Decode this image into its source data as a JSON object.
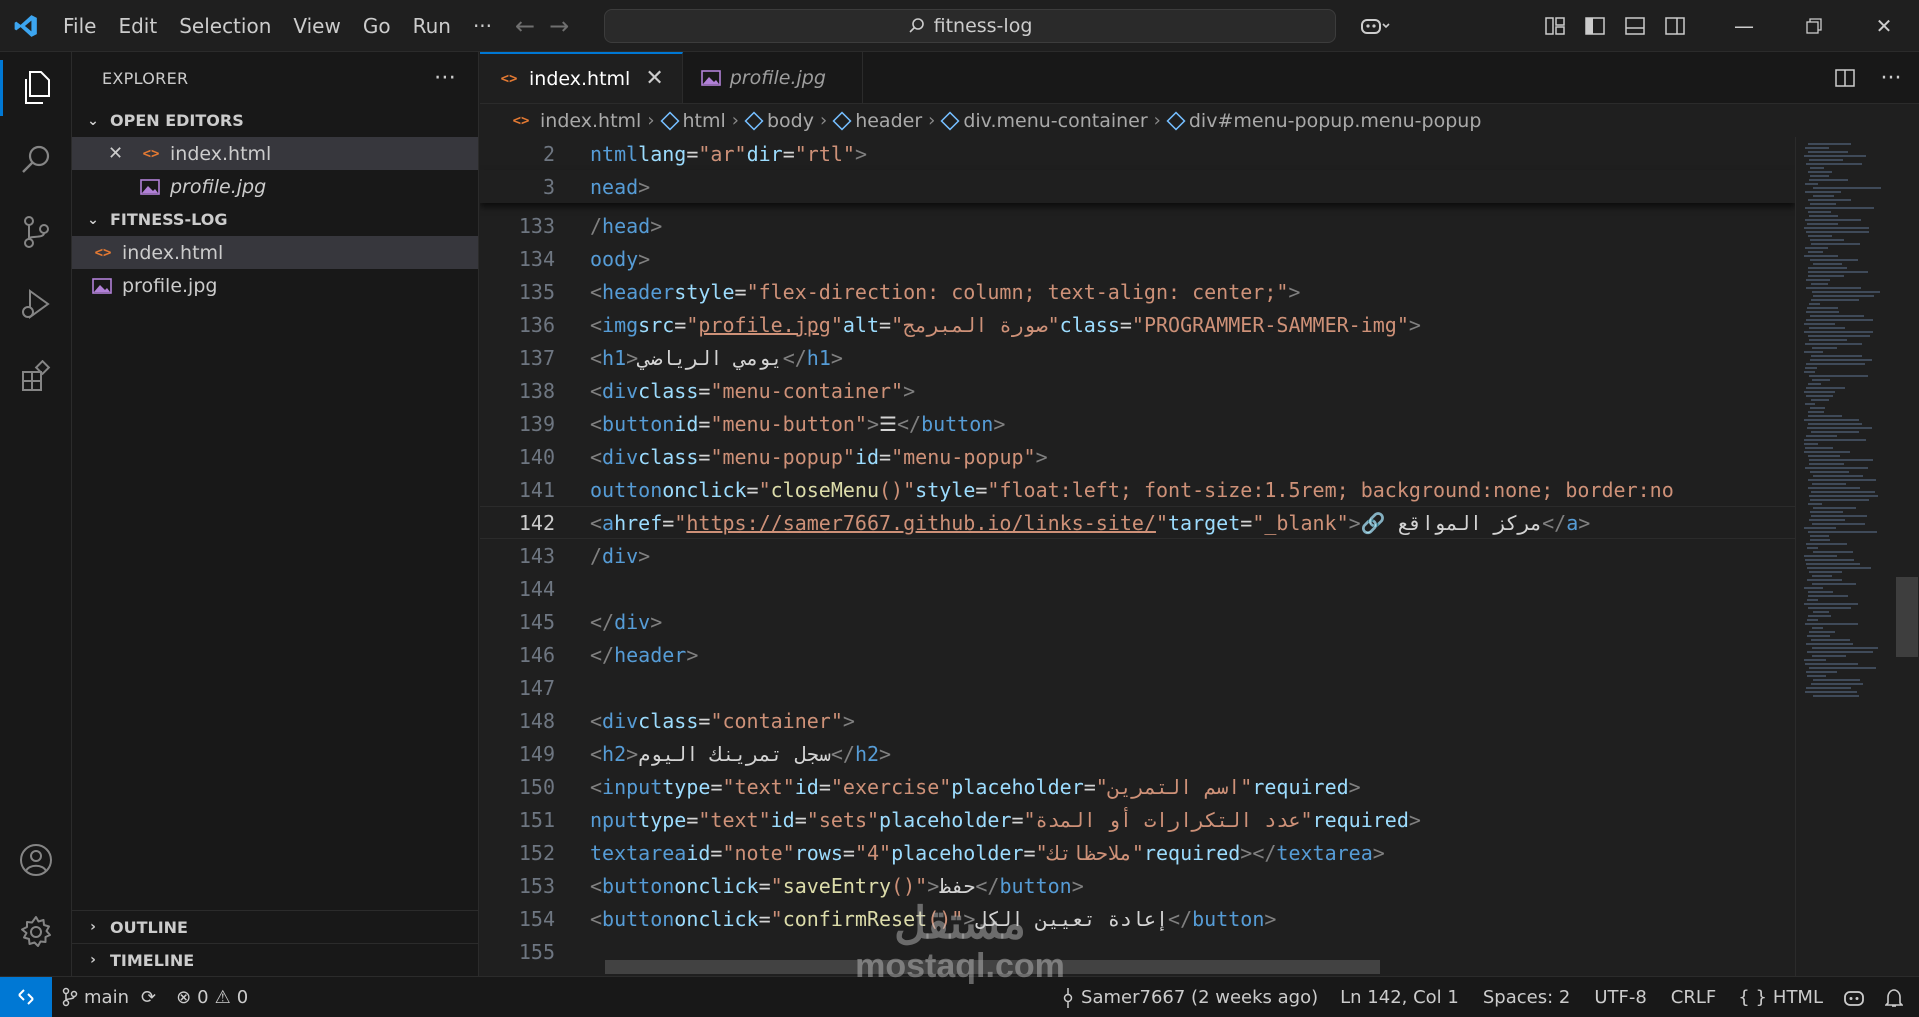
{
  "colors": {
    "accent": "#0078d4",
    "background": "#1f1f1f",
    "sidebar": "#181818",
    "tag": "#569cd6",
    "attr": "#9cdcfe",
    "string": "#ce9178",
    "function": "#dcdcaa",
    "htmlIcon": "#e37933",
    "imgIcon": "#b180d7"
  },
  "menubar": {
    "items": [
      "File",
      "Edit",
      "Selection",
      "View",
      "Go",
      "Run"
    ],
    "more": "···"
  },
  "command_center": {
    "text": "fitness-log"
  },
  "sidebar": {
    "title": "EXPLORER",
    "more": "···",
    "open_editors": {
      "title": "OPEN EDITORS",
      "files": [
        {
          "name": "index.html",
          "icon": "html-icon",
          "italic": false
        },
        {
          "name": "profile.jpg",
          "icon": "image-icon",
          "italic": true
        }
      ]
    },
    "folder": {
      "title": "FITNESS-LOG",
      "files": [
        {
          "name": "index.html",
          "icon": "html-icon"
        },
        {
          "name": "profile.jpg",
          "icon": "image-icon"
        }
      ]
    },
    "outline": "OUTLINE",
    "timeline": "TIMELINE"
  },
  "tabs": [
    {
      "label": "index.html",
      "active": true
    },
    {
      "label": "profile.jpg",
      "active": false
    }
  ],
  "breadcrumb": [
    "index.html",
    "html",
    "body",
    "header",
    "div.menu-container",
    "div#menu-popup.menu-popup"
  ],
  "sticky_lines": [
    {
      "n": "2",
      "code": "ntml lang=\"ar\" dir=\"rtl\">"
    },
    {
      "n": "3",
      "code": "nead>"
    }
  ],
  "code_lines": [
    {
      "n": "133",
      "code": "/head>"
    },
    {
      "n": "134",
      "code": "oody>"
    },
    {
      "n": "135",
      "code": " <header style=\"flex-direction: column; text-align: center;\">"
    },
    {
      "n": "136",
      "code": " <img src=\"profile.jpg\" alt=\"صورة المبرمج\" class=\"PROGRAMMER-SAMMER-img\">"
    },
    {
      "n": "137",
      "code": " <h1>يومي الرياضي</h1>"
    },
    {
      "n": "138",
      "code": " <div class=\"menu-container\">"
    },
    {
      "n": "139",
      "code": "     <button id=\"menu-button\">☰</button>"
    },
    {
      "n": "140",
      "code": "     <div class=\"menu-popup\" id=\"menu-popup\">"
    },
    {
      "n": "141",
      "code": "outton onclick=\"closeMenu()\" style=\"float:left; font-size:1.5rem; background:none; border:no"
    },
    {
      "n": "142",
      "code": " <a href=\"https://samer7667.github.io/links-site/\" target=\"_blank\">🔗 مركز المواقع</a>"
    },
    {
      "n": "143",
      "code": "/div>"
    },
    {
      "n": "144",
      "code": ""
    },
    {
      "n": "145",
      "code": "   </div>"
    },
    {
      "n": "146",
      "code": " </header>"
    },
    {
      "n": "147",
      "code": ""
    },
    {
      "n": "148",
      "code": " <div class=\"container\">"
    },
    {
      "n": "149",
      "code": "   <h2>سجل تمرينك اليوم</h2>"
    },
    {
      "n": "150",
      "code": "   <input type=\"text\" id=\"exercise\" placeholder=\"اسم التمرين\" required>"
    },
    {
      "n": "151",
      "code": "nput type=\"text\" id=\"sets\" placeholder=\"عدد التكرارات أو المدة\" required>"
    },
    {
      "n": "152",
      "code": "textarea id=\"note\" rows=\"4\" placeholder=\"ملاحظاتك\" required></textarea>"
    },
    {
      "n": "153",
      "code": "   <button onclick=\"saveEntry()\">حفظ</button>"
    },
    {
      "n": "154",
      "code": "   <button onclick=\"confirmReset()\">إعادة تعيين الكل</button>"
    },
    {
      "n": "155",
      "code": ""
    }
  ],
  "current_line": "142",
  "statusbar": {
    "branch": "main",
    "errors": "0",
    "warnings": "0",
    "blame": "Samer7667 (2 weeks ago)",
    "position": "Ln 142, Col 1",
    "spaces": "Spaces: 2",
    "encoding": "UTF-8",
    "eol": "CRLF",
    "language": "HTML"
  },
  "watermark": {
    "arabic": "مستقل",
    "latin": "mostaql.com"
  }
}
